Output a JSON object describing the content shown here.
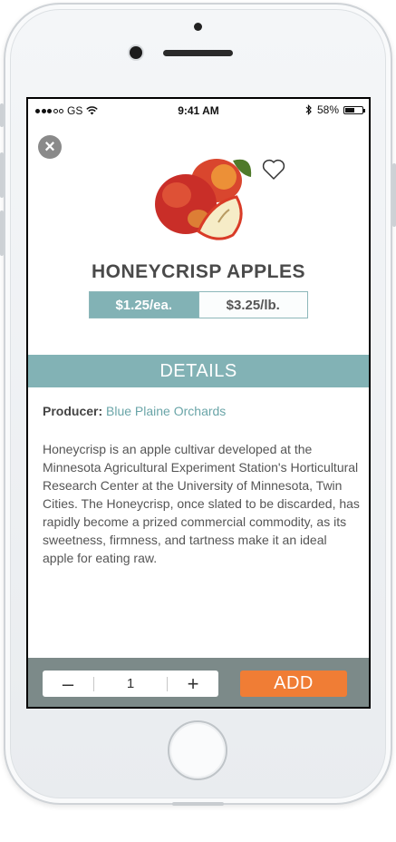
{
  "status_bar": {
    "carrier": "GS",
    "time": "9:41 AM",
    "battery": "58%",
    "battery_level": 0.58
  },
  "product": {
    "title": "HONEYCRISP APPLES",
    "image_icon": "apple-photo",
    "favorite_icon": "heart-icon",
    "close_icon": "close-icon"
  },
  "pricing": {
    "options": [
      {
        "label": "$1.25/ea.",
        "selected": true
      },
      {
        "label": "$3.25/lb.",
        "selected": false
      }
    ]
  },
  "details": {
    "header": "DETAILS",
    "producer_label": "Producer:",
    "producer_name": "Blue Plaine Orchards",
    "description": "Honeycrisp is an apple cultivar developed at the Minnesota Agricultural Experiment Station's Horticultural Research Center at the University of Minnesota, Twin Cities. The Honeycrisp, once slated to be discarded, has rapidly become a prized commercial commodity, as its sweetness, firmness, and tartness make it an ideal apple for eating raw."
  },
  "actions": {
    "decrement_label": "–",
    "quantity": "1",
    "increment_label": "+",
    "add_label": "ADD"
  },
  "colors": {
    "accent_teal": "#82b2b5",
    "add_orange": "#f07d35",
    "bar_gray": "#7c8a89"
  }
}
